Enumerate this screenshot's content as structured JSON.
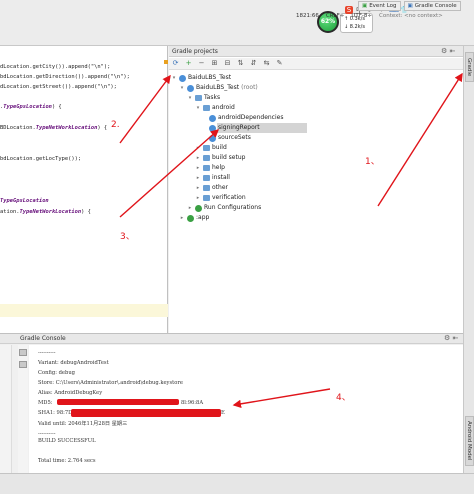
{
  "tray": {
    "gauge_percent": "62%",
    "speed_up": "0.3k/s",
    "speed_down": "8.2k/s"
  },
  "editor": {
    "lines": [
      {
        "pre": "dLocation.getCity()).append(\"\\n\");",
        "kw": "",
        "post": ""
      },
      {
        "pre": "bdLocation.getDirection()).append(\"\\n\");",
        "kw": "",
        "post": ""
      },
      {
        "pre": "dLocation.getStreet()).append(\"\\n\");",
        "kw": "",
        "post": ""
      },
      {
        "pre": ".",
        "kw": "TypeGpsLocation",
        "post": ") {"
      },
      {
        "pre": "BDLocation.",
        "kw": "TypeNetWorkLocation",
        "post": ") {"
      },
      {
        "pre": "bdLocation.getLocType());",
        "kw": "",
        "post": ""
      },
      {
        "pre": "",
        "kw": "TypeGpsLocation",
        "post": ""
      },
      {
        "pre": "ation.",
        "kw": "TypeNetWorkLocation",
        "post": ") {"
      }
    ]
  },
  "gradle": {
    "title": "Gradle projects",
    "tree": [
      {
        "label": "BaiduLBS_Test",
        "suffix": ""
      },
      {
        "label": "BaiduLBS_Test",
        "suffix": " (root)"
      },
      {
        "label": "Tasks",
        "suffix": ""
      },
      {
        "label": "android",
        "suffix": ""
      },
      {
        "label": "androidDependencies",
        "suffix": ""
      },
      {
        "label": "signingReport",
        "suffix": ""
      },
      {
        "label": "sourceSets",
        "suffix": ""
      },
      {
        "label": "build",
        "suffix": ""
      },
      {
        "label": "build setup",
        "suffix": ""
      },
      {
        "label": "help",
        "suffix": ""
      },
      {
        "label": "install",
        "suffix": ""
      },
      {
        "label": "other",
        "suffix": ""
      },
      {
        "label": "verification",
        "suffix": ""
      },
      {
        "label": "Run Configurations",
        "suffix": ""
      },
      {
        "label": ":app",
        "suffix": ""
      }
    ]
  },
  "right_tabs": {
    "gradle": "Gradle",
    "android_model": "Android Model"
  },
  "console": {
    "title": "Gradle Console",
    "lines": [
      "----------",
      "Variant: debugAndroidTest",
      "Config: debug",
      "Store: C:\\Users\\Administrator\\.android\\debug.keystore",
      "Alias: AndroidDebugKey",
      "MD5:",
      "SHA1: 98:7D",
      "Valid until: 2046年11月28日 星期三",
      "----------",
      "",
      "BUILD SUCCESSFUL",
      "",
      "Total time: 2.764 secs"
    ],
    "md5_tail": "8l:96:8A",
    "sha1_tail": "E"
  },
  "status": {
    "event_log": "Event Log",
    "gradle_console": "Gradle Console",
    "position": "1821:66",
    "line_sep": "CRLF÷",
    "encoding": "UTF-8÷",
    "context": "Context: <no context>"
  },
  "annotations": [
    "1、",
    "2.",
    "3、",
    "4、"
  ],
  "colors": {
    "accent_red": "#e0141a",
    "gauge_green": "#2cb64b",
    "selection": "#d4d4d4"
  }
}
